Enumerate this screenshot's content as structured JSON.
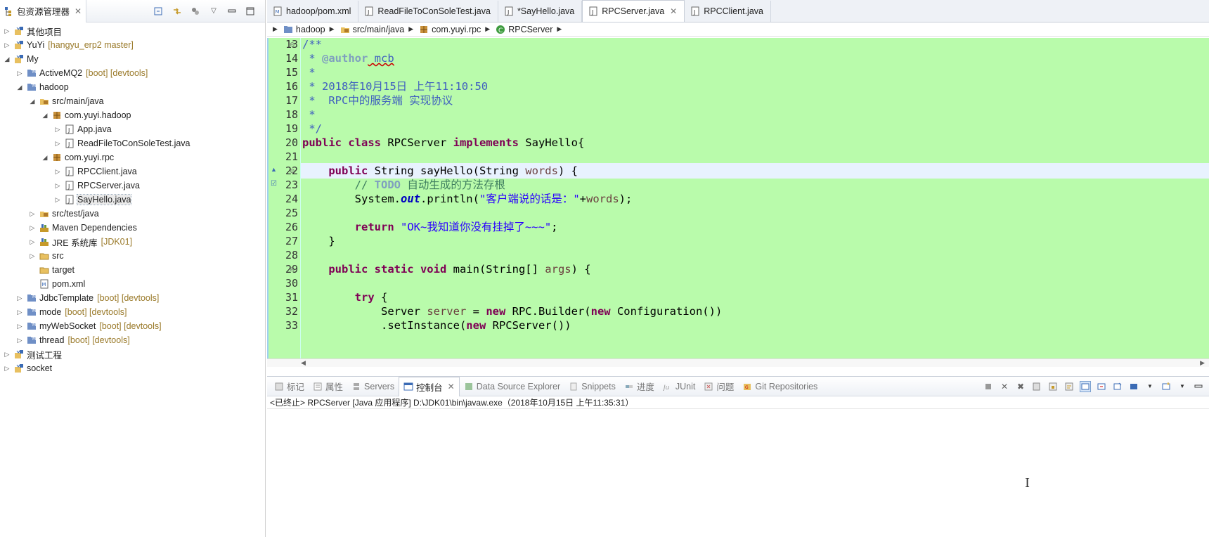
{
  "explorer": {
    "title": "包资源管理器",
    "tree": [
      {
        "label": "其他项目",
        "deco": "",
        "icon": "working-set-icon",
        "level": 0,
        "exp": "closed"
      },
      {
        "label": "YuYi",
        "deco": "[hangyu_erp2 master]",
        "icon": "working-set-icon",
        "level": 0,
        "exp": "closed"
      },
      {
        "label": "My",
        "deco": "",
        "icon": "working-set-icon",
        "level": 0,
        "exp": "open"
      },
      {
        "label": "ActiveMQ2",
        "deco": "[boot] [devtools]",
        "icon": "project-icon",
        "level": 1,
        "exp": "closed"
      },
      {
        "label": "hadoop",
        "deco": "",
        "icon": "project-icon",
        "level": 1,
        "exp": "open"
      },
      {
        "label": "src/main/java",
        "deco": "",
        "icon": "source-folder-icon",
        "level": 2,
        "exp": "open"
      },
      {
        "label": "com.yuyi.hadoop",
        "deco": "",
        "icon": "package-icon",
        "level": 3,
        "exp": "open"
      },
      {
        "label": "App.java",
        "deco": "",
        "icon": "java-file-icon",
        "level": 4,
        "exp": "closed"
      },
      {
        "label": "ReadFileToConSoleTest.java",
        "deco": "",
        "icon": "java-file-icon",
        "level": 4,
        "exp": "closed"
      },
      {
        "label": "com.yuyi.rpc",
        "deco": "",
        "icon": "package-icon",
        "level": 3,
        "exp": "open"
      },
      {
        "label": "RPCClient.java",
        "deco": "",
        "icon": "java-file-icon",
        "level": 4,
        "exp": "closed"
      },
      {
        "label": "RPCServer.java",
        "deco": "",
        "icon": "java-file-icon",
        "level": 4,
        "exp": "closed"
      },
      {
        "label": "SayHello.java",
        "deco": "",
        "icon": "java-file-icon",
        "level": 4,
        "exp": "closed"
      },
      {
        "label": "src/test/java",
        "deco": "",
        "icon": "source-folder-icon",
        "level": 2,
        "exp": "closed"
      },
      {
        "label": "Maven Dependencies",
        "deco": "",
        "icon": "library-icon",
        "level": 2,
        "exp": "closed"
      },
      {
        "label": "JRE 系统库",
        "deco": "[JDK01]",
        "icon": "library-icon",
        "level": 2,
        "exp": "closed"
      },
      {
        "label": "src",
        "deco": "",
        "icon": "folder-icon",
        "level": 2,
        "exp": "closed"
      },
      {
        "label": "target",
        "deco": "",
        "icon": "folder-icon",
        "level": 2,
        "exp": "none"
      },
      {
        "label": "pom.xml",
        "deco": "",
        "icon": "xml-file-icon",
        "level": 2,
        "exp": "none"
      },
      {
        "label": "JdbcTemplate",
        "deco": "[boot] [devtools]",
        "icon": "project-icon",
        "level": 1,
        "exp": "closed"
      },
      {
        "label": "mode",
        "deco": "[boot] [devtools]",
        "icon": "project-icon",
        "level": 1,
        "exp": "closed"
      },
      {
        "label": "myWebSocket",
        "deco": "[boot] [devtools]",
        "icon": "project-icon",
        "level": 1,
        "exp": "closed"
      },
      {
        "label": "thread",
        "deco": "[boot] [devtools]",
        "icon": "project-icon",
        "level": 1,
        "exp": "closed"
      },
      {
        "label": "测试工程",
        "deco": "",
        "icon": "working-set-icon",
        "level": 0,
        "exp": "closed"
      },
      {
        "label": "socket",
        "deco": "",
        "icon": "working-set-icon",
        "level": 0,
        "exp": "closed"
      }
    ]
  },
  "editor": {
    "tabs": [
      {
        "label": "hadoop/pom.xml",
        "icon": "xml-file-icon"
      },
      {
        "label": "ReadFileToConSoleTest.java",
        "icon": "java-file-icon"
      },
      {
        "label": "*SayHello.java",
        "icon": "java-file-icon"
      },
      {
        "label": "RPCServer.java",
        "icon": "java-file-icon"
      },
      {
        "label": "RPCClient.java",
        "icon": "java-file-icon"
      }
    ],
    "breadcrumb": [
      "hadoop",
      "src/main/java",
      "com.yuyi.rpc",
      "RPCServer"
    ],
    "line_numbers": [
      "13",
      "14",
      "15",
      "16",
      "17",
      "18",
      "19",
      "20",
      "21",
      "22",
      "23",
      "24",
      "25",
      "26",
      "27",
      "28",
      "29",
      "30",
      "31",
      "32",
      "33"
    ],
    "code": {
      "l13": "/**",
      "l14a": " * ",
      "l14b": "@author",
      "l14c": " mcb",
      "l15": " *",
      "l16": " * 2018年10月15日 上午11:10:50",
      "l17": " *  RPC中的服务端 实现协议",
      "l18": " *",
      "l19": " */",
      "l20a": "public class",
      "l20b": " RPCServer ",
      "l20c": "implements",
      "l20d": " SayHello{",
      "l22a": "    ",
      "l22b": "public",
      "l22c": " String sayHello(String ",
      "l22d": "words",
      "l22e": ") {",
      "l23a": "        // ",
      "l23b": "TODO",
      "l23c": " 自动生成的方法存根",
      "l24a": "        System.",
      "l24b": "out",
      "l24c": ".println(",
      "l24d": "\"客户端说的话是：\"",
      "l24e": "+",
      "l24f": "words",
      "l24g": ");",
      "l26a": "        ",
      "l26b": "return",
      "l26c": " ",
      "l26d": "\"OK~我知道你没有挂掉了~~~\"",
      "l26e": ";",
      "l27": "    }",
      "l29a": "    ",
      "l29b": "public static void",
      "l29c": " main(String[] ",
      "l29d": "args",
      "l29e": ") {",
      "l31a": "        ",
      "l31b": "try",
      "l31c": " {",
      "l32a": "            Server ",
      "l32b": "server",
      "l32c": " = ",
      "l32d": "new",
      "l32e": " RPC.Builder(",
      "l32f": "new",
      "l32g": " Configuration())",
      "l33a": "            .setInstance(",
      "l33b": "new",
      "l33c": " RPCServer())"
    }
  },
  "console": {
    "tabs": [
      {
        "label": "标记",
        "icon": "markers-icon"
      },
      {
        "label": "属性",
        "icon": "properties-icon"
      },
      {
        "label": "Servers",
        "icon": "servers-icon"
      },
      {
        "label": "控制台",
        "icon": "console-icon"
      },
      {
        "label": "Data Source Explorer",
        "icon": "data-source-icon"
      },
      {
        "label": "Snippets",
        "icon": "snippets-icon"
      },
      {
        "label": "进度",
        "icon": "progress-icon"
      },
      {
        "label": "JUnit",
        "icon": "junit-icon"
      },
      {
        "label": "问题",
        "icon": "problems-icon"
      },
      {
        "label": "Git Repositories",
        "icon": "git-icon"
      }
    ],
    "status": "<已终止> RPCServer [Java 应用程序] D:\\JDK01\\bin\\javaw.exe（2018年10月15日 上午11:35:31）"
  },
  "colors": {
    "editor_bg": "#b9fbab",
    "keyword": "#7f0055",
    "javadoc": "#3f5fbf",
    "comment": "#3f7f5f",
    "string": "#2a00ff"
  }
}
